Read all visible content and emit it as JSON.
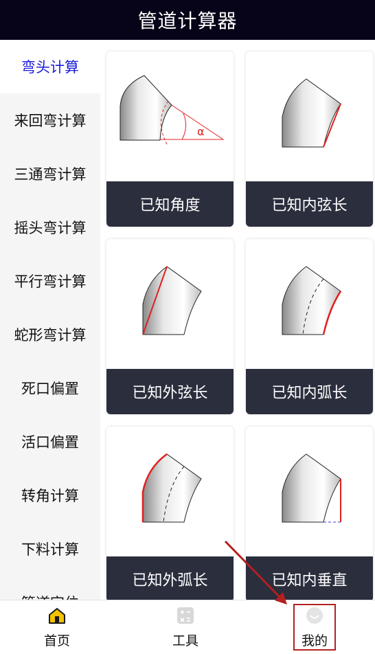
{
  "header": {
    "title": "管道计算器"
  },
  "sidebar": {
    "items": [
      {
        "label": "弯头计算",
        "active": true
      },
      {
        "label": "来回弯计算"
      },
      {
        "label": "三通弯计算"
      },
      {
        "label": "摇头弯计算"
      },
      {
        "label": "平行弯计算"
      },
      {
        "label": "蛇形弯计算"
      },
      {
        "label": "死口偏置"
      },
      {
        "label": "活口偏置"
      },
      {
        "label": "转角计算"
      },
      {
        "label": "下料计算"
      },
      {
        "label": "管道定位"
      }
    ]
  },
  "cards": [
    {
      "label": "已知角度",
      "diagram_text": "α"
    },
    {
      "label": "已知内弦长"
    },
    {
      "label": "已知外弦长"
    },
    {
      "label": "已知内弧长"
    },
    {
      "label": "已知外弧长"
    },
    {
      "label": "已知内垂直"
    }
  ],
  "tabbar": {
    "tabs": [
      {
        "label": "首页",
        "icon": "home-icon"
      },
      {
        "label": "工具",
        "icon": "calculator-icon"
      },
      {
        "label": "我的",
        "icon": "profile-icon"
      }
    ]
  },
  "colors": {
    "header_bg": "#070318",
    "active_text": "#1a1adb",
    "card_label_bg": "#2b2e3d",
    "highlight": "#b32020"
  }
}
